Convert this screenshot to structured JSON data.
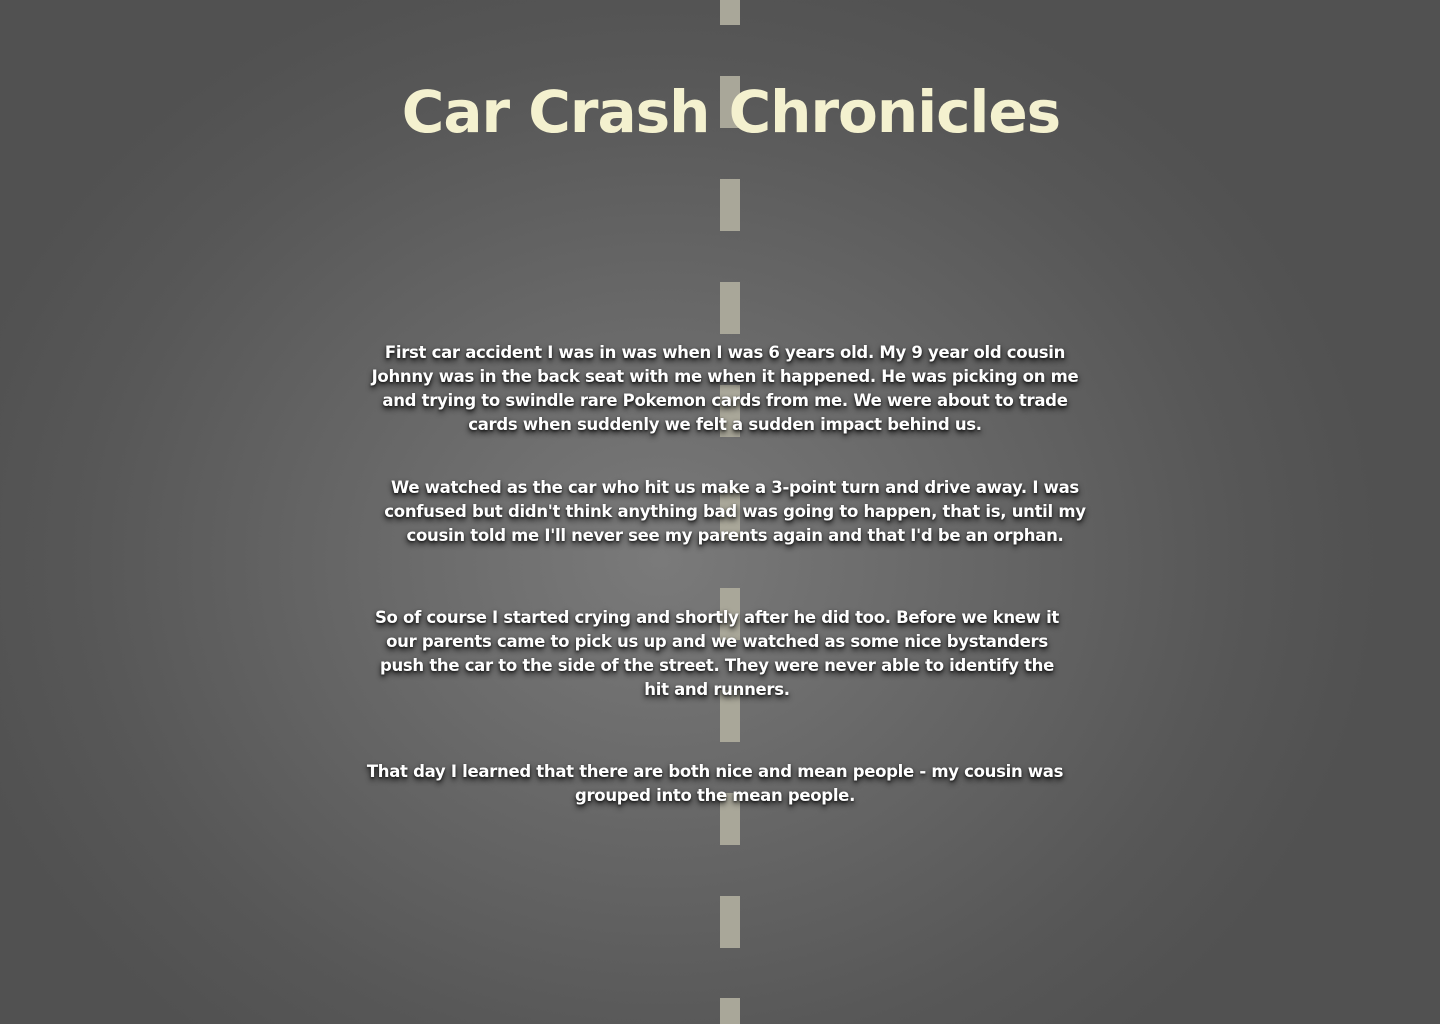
{
  "page": {
    "title": "Car Crash Chronicles"
  },
  "story": {
    "paragraphs": [
      "First car accident I was in was when I was 6 years old. My 9 year old cousin Johnny was in the back seat with me when it happened. He was picking on me and trying to swindle rare Pokemon cards from me. We were about to trade cards when suddenly we felt a sudden impact behind us.",
      "We watched as the car who hit us make a 3-point turn and drive away. I was confused but didn't think anything bad was going to happen, that is, until my cousin told me I'll never see my parents again and that I'd be an orphan.",
      "So of course I started crying and shortly after he did too. Before we knew it our parents came to pick us up and we watched as some nice bystanders push the car to the side of the street. They were never able to identify the hit and runners.",
      "That day I learned that there are both nice and mean people - my cousin was grouped into the mean people."
    ]
  },
  "colors": {
    "title": "#f4f1cf",
    "body_text": "#ffffff",
    "road_dash": "#a9a799",
    "asphalt": "#5a5a5a"
  }
}
